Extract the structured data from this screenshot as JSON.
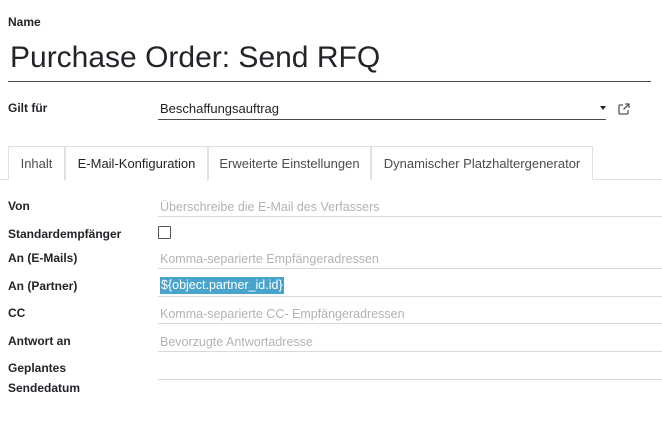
{
  "header": {
    "name_label": "Name",
    "title": "Purchase Order: Send RFQ"
  },
  "applies_to": {
    "label": "Gilt für",
    "value": "Beschaffungsauftrag",
    "icons": [
      "caret-down-icon",
      "external-link-icon"
    ]
  },
  "tabs": [
    {
      "label": "Inhalt",
      "active": false
    },
    {
      "label": "E-Mail-Konfiguration",
      "active": true
    },
    {
      "label": "Erweiterte Einstellungen",
      "active": false
    },
    {
      "label": "Dynamischer Platzhaltergenerator",
      "active": false
    }
  ],
  "fields": {
    "from": {
      "label": "Von",
      "placeholder": "Überschreibe die E-Mail des Verfassers"
    },
    "default_recipients": {
      "label": "Standardempfänger",
      "checked": false
    },
    "to_emails": {
      "label": "An (E-Mails)",
      "placeholder": "Komma-separierte Empfängeradressen"
    },
    "to_partner": {
      "label": "An (Partner)",
      "value": "${object.partner_id.id}"
    },
    "cc": {
      "label": "CC",
      "placeholder": "Komma-separierte CC- Empfängeradressen"
    },
    "reply_to": {
      "label": "Antwort an",
      "placeholder": "Bevorzugte Antwortadresse"
    },
    "scheduled_date": {
      "label_line1": "Geplantes",
      "label_line2": "Sendedatum",
      "value": ""
    }
  },
  "colors": {
    "selection": "#49a4cc",
    "placeholder": "#b3b3b3",
    "border": "#dee2e6"
  }
}
